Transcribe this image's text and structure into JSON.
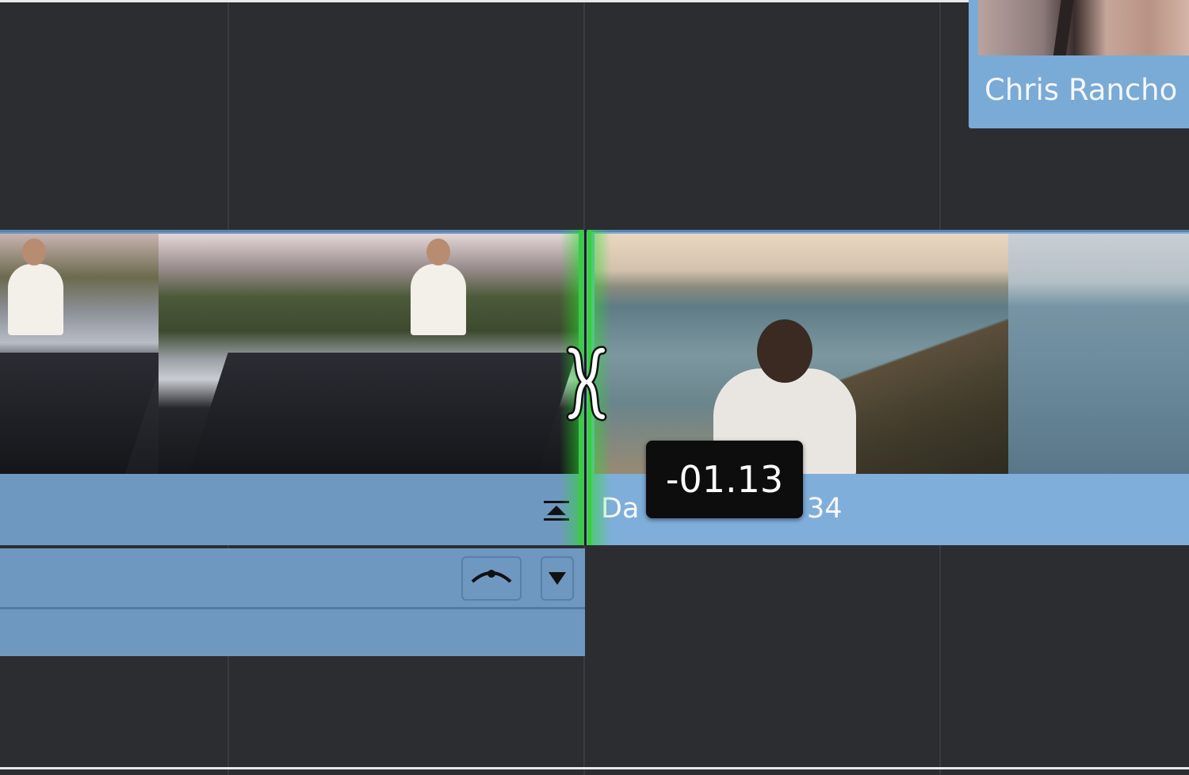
{
  "timeline": {
    "top_clip": {
      "label": "Chris Rancho"
    },
    "video_track": {
      "incoming_clip_label_left": "Da",
      "incoming_clip_label_right": "34"
    },
    "trim_tooltip": {
      "value": "-01.13"
    }
  },
  "colors": {
    "background": "#2c2d31",
    "clip_blue": "#80aedb",
    "clip_blue_dim": "#6f98c1",
    "edit_point_green": "#34d234",
    "tooltip_bg": "#0d0d0e"
  },
  "icons": {
    "flatten": "flatten-icon",
    "keyframe_curve": "curve-icon",
    "dropdown": "chevron-down-icon",
    "trim_cursor": "roll-trim-icon"
  }
}
